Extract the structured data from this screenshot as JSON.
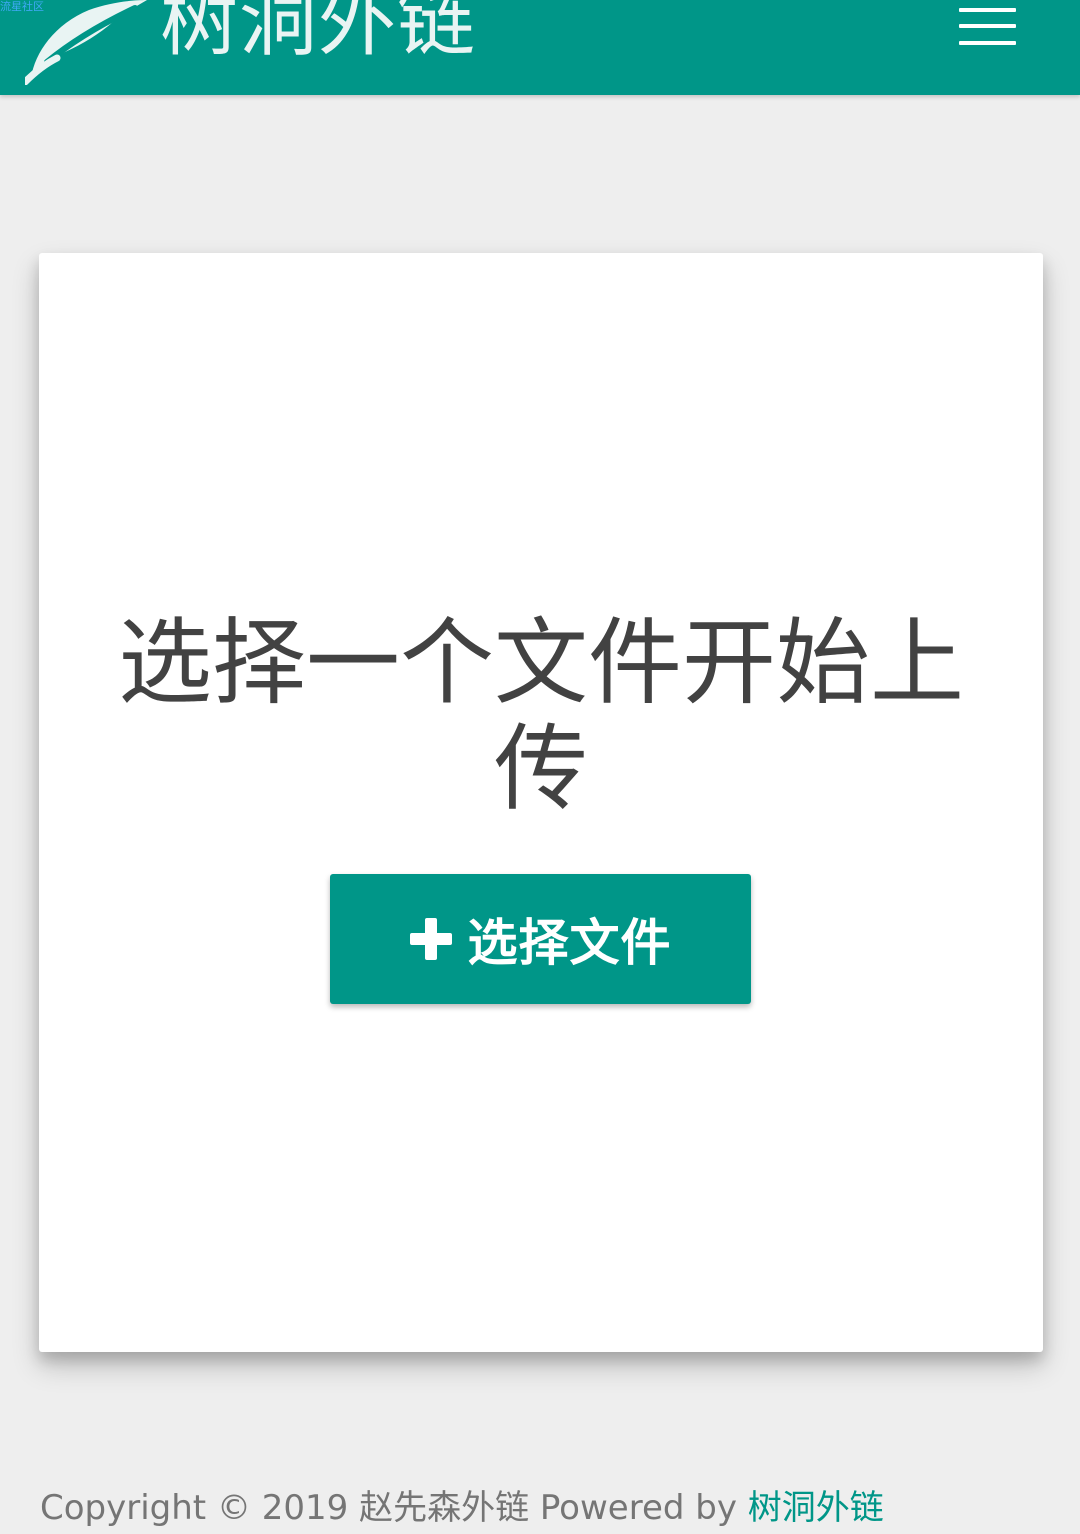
{
  "header": {
    "corner_link": "流星社区",
    "logo_text": "树洞外链",
    "menu_icon": "hamburger-menu-icon",
    "logo_icon": "leaf-logo-icon"
  },
  "upload_card": {
    "title": "选择一个文件开始上传",
    "button_label": "选择文件",
    "button_icon": "plus-icon"
  },
  "footer": {
    "copyright": "Copyright © 2019 赵先森外链 Powered by ",
    "link_text": "树洞外链"
  },
  "colors": {
    "brand": "#009688",
    "page_background": "#eeeeee",
    "card_background": "#ffffff",
    "title_text": "#424242",
    "footer_text": "#757575",
    "corner_link": "#3fa9f5"
  }
}
